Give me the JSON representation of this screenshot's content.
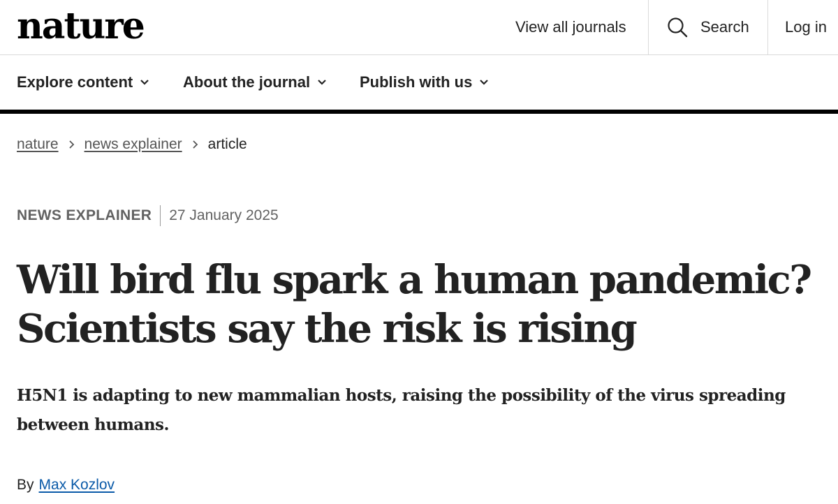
{
  "header": {
    "logo": "nature",
    "view_all_journals": "View all journals",
    "search_label": "Search",
    "login_label": "Log in"
  },
  "nav": {
    "items": [
      {
        "label": "Explore content"
      },
      {
        "label": "About the journal"
      },
      {
        "label": "Publish with us"
      }
    ]
  },
  "breadcrumb": {
    "items": [
      {
        "label": "nature"
      },
      {
        "label": "news explainer"
      },
      {
        "label": "article"
      }
    ]
  },
  "article": {
    "type": "NEWS EXPLAINER",
    "date": "27 January 2025",
    "title": "Will bird flu spark a human pandemic? Scientists say the risk is rising",
    "standfirst": "H5N1 is adapting to new mammalian hosts, raising the possibility of the virus spreading between humans.",
    "byline_prefix": "By",
    "author": "Max Kozlov"
  },
  "colors": {
    "text": "#222222",
    "muted": "#626262",
    "link": "#0a5aa8",
    "rule": "#000000"
  }
}
